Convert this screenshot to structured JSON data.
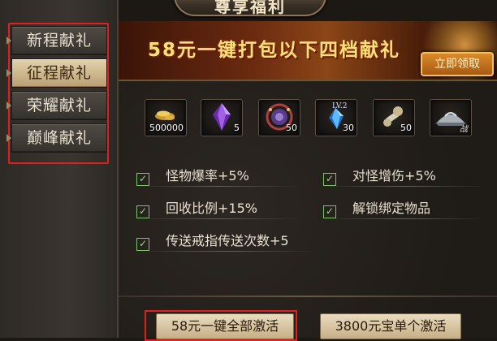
{
  "header": {
    "title": "尊享福利"
  },
  "sidebar": {
    "items": [
      {
        "label": "新程献礼",
        "active": false
      },
      {
        "label": "征程献礼",
        "active": true
      },
      {
        "label": "荣耀献礼",
        "active": false
      },
      {
        "label": "巅峰献礼",
        "active": false
      }
    ]
  },
  "banner": {
    "title": "58元一键打包以下四档献礼",
    "claim_label": "立即领取"
  },
  "rewards": [
    {
      "icon": "gold-ingots-icon",
      "qty": "500000"
    },
    {
      "icon": "purple-crystal-icon",
      "qty": "5"
    },
    {
      "icon": "rune-orb-icon",
      "qty": "50"
    },
    {
      "icon": "blue-gem-icon",
      "qty": "30",
      "level": "LV.2"
    },
    {
      "icon": "bone-wrench-icon",
      "qty": "50"
    },
    {
      "icon": "iron-hat-icon",
      "qty": "",
      "mark": "战"
    }
  ],
  "attributes": [
    "怪物爆率+5%",
    "对怪增伤+5%",
    "回收比例+15%",
    "解锁绑定物品",
    "传送戒指传送次数+5"
  ],
  "actions": {
    "activate_all": "58元一键全部激活",
    "activate_single": "3800元宝单个激活"
  },
  "colors": {
    "highlight_frame": "#e02020",
    "check_green": "#8ee07a",
    "banner_gold": "#ffe27a"
  }
}
